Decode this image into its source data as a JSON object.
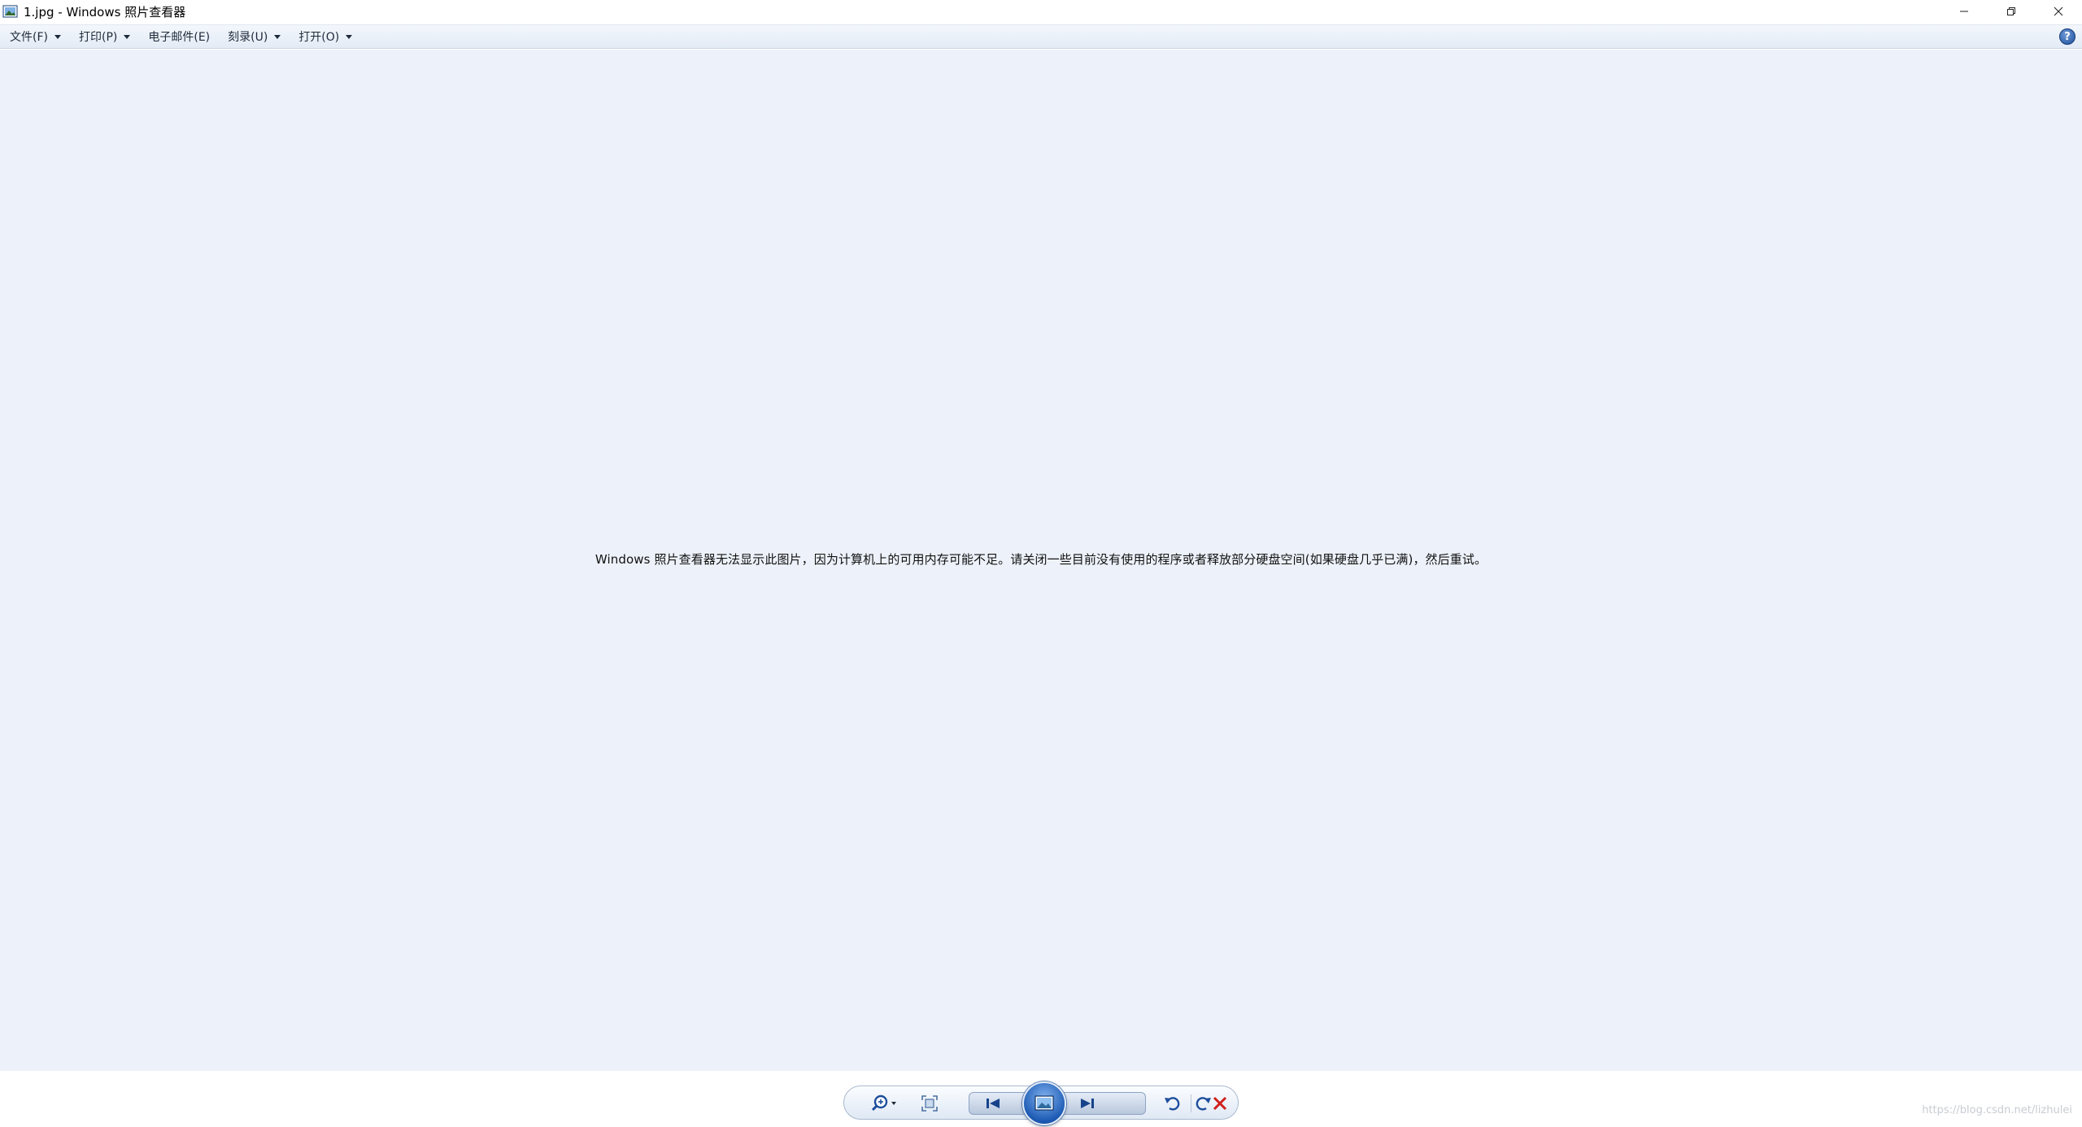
{
  "window": {
    "title": "1.jpg - Windows 照片查看器"
  },
  "menu": {
    "items": [
      {
        "label": "文件(F)"
      },
      {
        "label": "打印(P)"
      },
      {
        "label": "电子邮件(E)"
      },
      {
        "label": "刻录(U)"
      },
      {
        "label": "打开(O)"
      }
    ],
    "help_label": "?"
  },
  "viewer": {
    "message": "Windows 照片查看器无法显示此图片，因为计算机上的可用内存可能不足。请关闭一些目前没有使用的程序或者释放部分硬盘空间(如果硬盘几乎已满)，然后重试。"
  },
  "toolbar": {
    "icons": [
      "zoom-icon",
      "actual-size-icon",
      "previous-icon",
      "slideshow-icon",
      "next-icon",
      "rotate-left-icon",
      "rotate-right-icon",
      "delete-icon"
    ],
    "accent_color": "#1d5bb4",
    "delete_color": "#d0201a"
  },
  "watermark": {
    "text": "https://blog.csdn.net/lizhulei"
  }
}
